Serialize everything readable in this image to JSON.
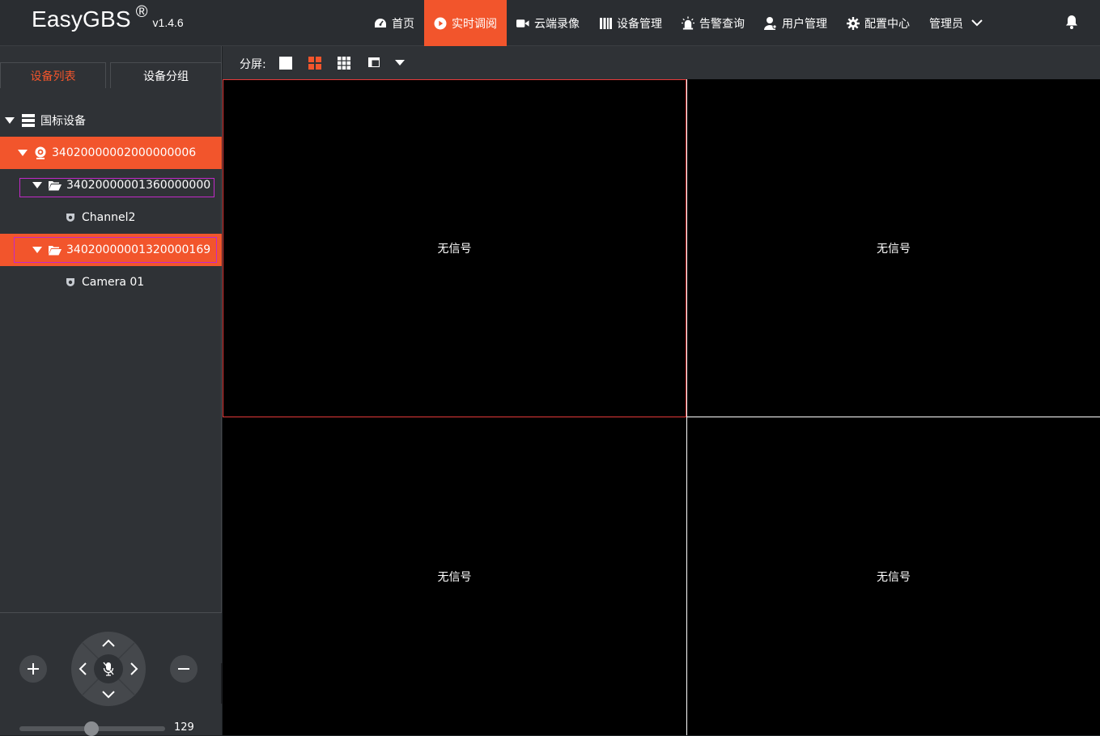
{
  "app": {
    "name": "EasyGBS",
    "reg": "®",
    "version": "v1.4.6"
  },
  "nav": [
    {
      "label": "首页",
      "icon": "dashboard-icon"
    },
    {
      "label": "实时调阅",
      "icon": "play-circle-icon",
      "active": true
    },
    {
      "label": "云端录像",
      "icon": "video-camera-icon"
    },
    {
      "label": "设备管理",
      "icon": "device-columns-icon"
    },
    {
      "label": "告警查询",
      "icon": "alarm-light-icon"
    },
    {
      "label": "用户管理",
      "icon": "user-icon"
    },
    {
      "label": "配置中心",
      "icon": "gear-icon"
    }
  ],
  "user": {
    "label": "管理员"
  },
  "tabs": {
    "device_list": "设备列表",
    "device_group": "设备分组"
  },
  "tree": {
    "root": "国标设备",
    "device": "34020000002000000006",
    "folder1": "34020000001360000000",
    "channel1": "Channel2",
    "folder2": "34020000001320000169",
    "channel2": "Camera 01"
  },
  "toolbar": {
    "split_label": "分屏:"
  },
  "cells": [
    "无信号",
    "无信号",
    "无信号",
    "无信号"
  ],
  "ptz": {
    "speed": "129"
  },
  "colors": {
    "accent": "#f2552c",
    "panel": "#2f3236",
    "selection": "#c229c8"
  }
}
